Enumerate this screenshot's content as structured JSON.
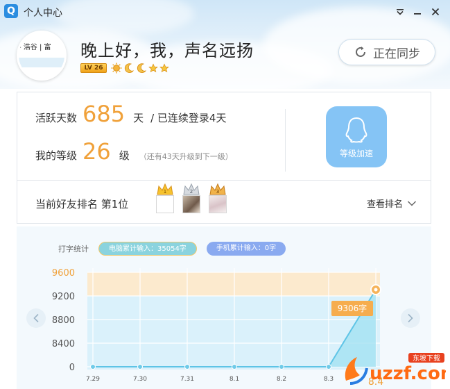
{
  "window": {
    "title": "个人中心",
    "logo_glyph": "Q"
  },
  "profile": {
    "avatar_strip_text": "- 浩谷 | 富",
    "greeting": "晚上好，我，声名远扬",
    "level_badge": "LV 26",
    "level_icons": [
      "sun-icon",
      "moon-icon",
      "moon-icon",
      "star-icon",
      "star-icon"
    ],
    "sync_label": "正在同步"
  },
  "stats": {
    "active_label": "活跃天数",
    "active_days": "685",
    "active_unit": "天",
    "streak_text": "/  已连续登录4天",
    "level_label": "我的等级",
    "level_value": "26",
    "level_unit": "级",
    "level_hint": "（还有43天升级到下一级）",
    "speedup_label": "等级加速",
    "friend_rank_text": "当前好友排名 第1位",
    "crowns": [
      "1",
      "2",
      "3"
    ],
    "view_rank_label": "查看排名"
  },
  "chart_section": {
    "title": "打字统计",
    "pc_pill": "电脑累计输入：35054字",
    "mobile_pill": "手机累计输入：0字",
    "tooltip": "9306字"
  },
  "colors": {
    "accent_orange": "#f0a13a",
    "line_blue": "#5ec4e6",
    "pill_pc": "#8ad3de",
    "pill_mobile": "#8aaaf0",
    "speedup": "#85c4f5"
  },
  "chart_data": {
    "type": "area",
    "x": [
      "7.29",
      "7.30",
      "7.31",
      "8.1",
      "8.2",
      "8.3",
      "8.4"
    ],
    "values": [
      0,
      0,
      0,
      14,
      12,
      24,
      9306
    ],
    "y_ticks": [
      "0",
      "8400",
      "8800",
      "9200",
      "9600"
    ],
    "last_label": "8.4",
    "x_label_partial": "8.3",
    "grid": true,
    "highlight_band": [
      "9200",
      "9600"
    ]
  },
  "watermark": {
    "brand": "uzzf.com",
    "tag": "东坡下载"
  }
}
